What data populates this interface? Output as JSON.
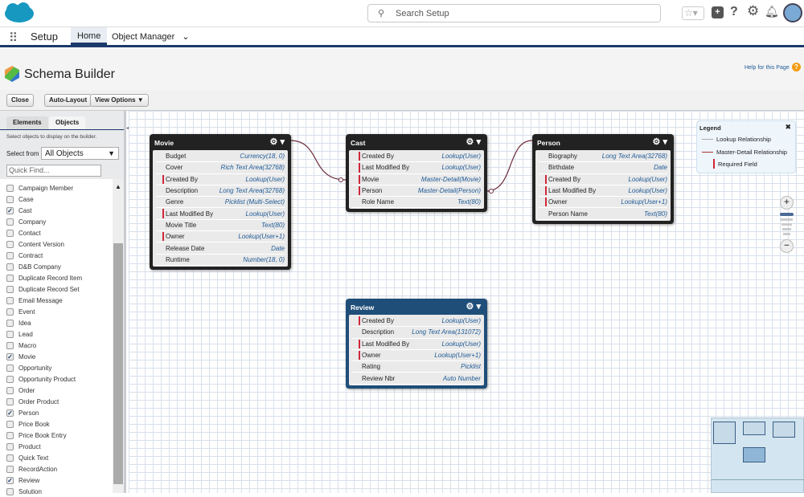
{
  "topbar": {
    "search_placeholder": "Search Setup"
  },
  "nav": {
    "app": "Setup",
    "tabs": [
      "Home",
      "Object Manager"
    ]
  },
  "header": {
    "title": "Schema Builder",
    "help": "Help for this Page"
  },
  "toolbar": {
    "close": "Close",
    "auto_layout": "Auto-Layout",
    "view_options": "View Options"
  },
  "left": {
    "tabs": [
      "Elements",
      "Objects"
    ],
    "hint": "Select objects to display on the builder.",
    "select_label": "Select from",
    "select_value": "All Objects",
    "quick_find": "Quick Find...",
    "items": [
      {
        "label": "Campaign Member",
        "checked": false
      },
      {
        "label": "Case",
        "checked": false
      },
      {
        "label": "Cast",
        "checked": true
      },
      {
        "label": "Company",
        "checked": false
      },
      {
        "label": "Contact",
        "checked": false
      },
      {
        "label": "Content Version",
        "checked": false
      },
      {
        "label": "Contract",
        "checked": false
      },
      {
        "label": "D&B Company",
        "checked": false
      },
      {
        "label": "Duplicate Record Item",
        "checked": false
      },
      {
        "label": "Duplicate Record Set",
        "checked": false
      },
      {
        "label": "Email Message",
        "checked": false
      },
      {
        "label": "Event",
        "checked": false
      },
      {
        "label": "Idea",
        "checked": false
      },
      {
        "label": "Lead",
        "checked": false
      },
      {
        "label": "Macro",
        "checked": false
      },
      {
        "label": "Movie",
        "checked": true
      },
      {
        "label": "Opportunity",
        "checked": false
      },
      {
        "label": "Opportunity Product",
        "checked": false
      },
      {
        "label": "Order",
        "checked": false
      },
      {
        "label": "Order Product",
        "checked": false
      },
      {
        "label": "Person",
        "checked": true
      },
      {
        "label": "Price Book",
        "checked": false
      },
      {
        "label": "Price Book Entry",
        "checked": false
      },
      {
        "label": "Product",
        "checked": false
      },
      {
        "label": "Quick Text",
        "checked": false
      },
      {
        "label": "RecordAction",
        "checked": false
      },
      {
        "label": "Review",
        "checked": true
      },
      {
        "label": "Solution",
        "checked": false
      }
    ]
  },
  "objects": [
    {
      "name": "Movie",
      "fields": [
        [
          "Budget",
          "Currency(18, 0)",
          false
        ],
        [
          "Cover",
          "Rich Text Area(32768)",
          false
        ],
        [
          "Created By",
          "Lookup(User)",
          true
        ],
        [
          "Description",
          "Long Text Area(32768)",
          false
        ],
        [
          "Genre",
          "Picklist (Multi-Select)",
          false
        ],
        [
          "Last Modified By",
          "Lookup(User)",
          true
        ],
        [
          "Movie Title",
          "Text(80)",
          false
        ],
        [
          "Owner",
          "Lookup(User+1)",
          true
        ],
        [
          "Release Date",
          "Date",
          false
        ],
        [
          "Runtime",
          "Number(18, 0)",
          false
        ]
      ]
    },
    {
      "name": "Cast",
      "fields": [
        [
          "Created By",
          "Lookup(User)",
          true
        ],
        [
          "Last Modified By",
          "Lookup(User)",
          true
        ],
        [
          "Movie",
          "Master-Detail(Movie)",
          true
        ],
        [
          "Person",
          "Master-Detail(Person)",
          true
        ],
        [
          "Role Name",
          "Text(80)",
          false
        ]
      ]
    },
    {
      "name": "Person",
      "fields": [
        [
          "Biography",
          "Long Text Area(32768)",
          false
        ],
        [
          "Birthdate",
          "Date",
          false
        ],
        [
          "Created By",
          "Lookup(User)",
          true
        ],
        [
          "Last Modified By",
          "Lookup(User)",
          true
        ],
        [
          "Owner",
          "Lookup(User+1)",
          true
        ],
        [
          "Person Name",
          "Text(80)",
          false
        ]
      ]
    },
    {
      "name": "Review",
      "fields": [
        [
          "Created By",
          "Lookup(User)",
          true
        ],
        [
          "Description",
          "Long Text Area(131072)",
          false
        ],
        [
          "Last Modified By",
          "Lookup(User)",
          true
        ],
        [
          "Owner",
          "Lookup(User+1)",
          true
        ],
        [
          "Rating",
          "Picklist",
          false
        ],
        [
          "Review Nbr",
          "Auto Number",
          false
        ]
      ]
    }
  ],
  "legend": {
    "title": "Legend",
    "lookup": "Lookup Relationship",
    "master": "Master-Detail Relationship",
    "required": "Required Field"
  },
  "colors": {
    "accent": "#1b3a6b",
    "master_detail": "#6b2a3a",
    "required": "#d0283a"
  }
}
